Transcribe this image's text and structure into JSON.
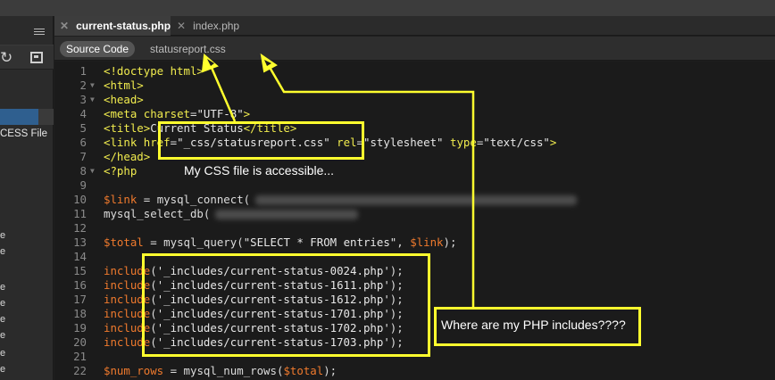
{
  "tabs": [
    {
      "label": "current-status.php",
      "active": true
    },
    {
      "label": "index.php",
      "active": false
    }
  ],
  "related_files": {
    "source_code_label": "Source Code",
    "files": [
      "statusreport.css"
    ]
  },
  "left_panel": {
    "file_label": "CESS File",
    "row_letter": "e"
  },
  "code_lines": [
    {
      "n": "1",
      "fold": false,
      "tokens": [
        [
          "t-tag",
          "<!doctype html>"
        ]
      ]
    },
    {
      "n": "2",
      "fold": true,
      "tokens": [
        [
          "t-tag",
          "<html>"
        ]
      ]
    },
    {
      "n": "3",
      "fold": true,
      "tokens": [
        [
          "t-tag",
          "<head>"
        ]
      ]
    },
    {
      "n": "4",
      "fold": false,
      "tokens": [
        [
          "t-tag",
          "<meta "
        ],
        [
          "t-attr",
          "charset"
        ],
        [
          "t-plain",
          "="
        ],
        [
          "t-str",
          "\"UTF-8\""
        ],
        [
          "t-tag",
          ">"
        ]
      ]
    },
    {
      "n": "5",
      "fold": false,
      "tokens": [
        [
          "t-tag",
          "<title>"
        ],
        [
          "t-text",
          "Current Status"
        ],
        [
          "t-tag",
          "</title>"
        ]
      ]
    },
    {
      "n": "6",
      "fold": false,
      "tokens": [
        [
          "t-tag",
          "<link "
        ],
        [
          "t-attr",
          "href"
        ],
        [
          "t-plain",
          "="
        ],
        [
          "t-str",
          "\"_css/statusreport.css\""
        ],
        [
          "t-plain",
          " "
        ],
        [
          "t-attr",
          "rel"
        ],
        [
          "t-plain",
          "="
        ],
        [
          "t-str",
          "\"stylesheet\""
        ],
        [
          "t-plain",
          " "
        ],
        [
          "t-attr",
          "type"
        ],
        [
          "t-plain",
          "="
        ],
        [
          "t-str",
          "\"text/css\""
        ],
        [
          "t-tag",
          ">"
        ]
      ]
    },
    {
      "n": "7",
      "fold": false,
      "tokens": [
        [
          "t-tag",
          "</head>"
        ]
      ]
    },
    {
      "n": "8",
      "fold": true,
      "tokens": [
        [
          "t-tag",
          "<?php"
        ]
      ]
    },
    {
      "n": "9",
      "fold": false,
      "tokens": []
    },
    {
      "n": "10",
      "fold": false,
      "tokens": [
        [
          "t-var",
          "$link"
        ],
        [
          "t-plain",
          " = "
        ],
        [
          "t-fn",
          "mysql_connect("
        ]
      ],
      "blur": 360
    },
    {
      "n": "11",
      "fold": false,
      "tokens": [
        [
          "t-fn",
          "mysql_select_db("
        ]
      ],
      "blur": 160
    },
    {
      "n": "12",
      "fold": false,
      "tokens": []
    },
    {
      "n": "13",
      "fold": false,
      "tokens": [
        [
          "t-var",
          "$total"
        ],
        [
          "t-plain",
          " = "
        ],
        [
          "t-fn",
          "mysql_query("
        ],
        [
          "t-str",
          "\"SELECT * FROM entries\""
        ],
        [
          "t-plain",
          ", "
        ],
        [
          "t-var",
          "$link"
        ],
        [
          "t-plain",
          ");"
        ]
      ]
    },
    {
      "n": "14",
      "fold": false,
      "tokens": []
    },
    {
      "n": "15",
      "fold": false,
      "tokens": [
        [
          "t-kw",
          "include"
        ],
        [
          "t-plain",
          "("
        ],
        [
          "t-str",
          "'_includes/current-status-0024.php'"
        ],
        [
          "t-plain",
          ");"
        ]
      ]
    },
    {
      "n": "16",
      "fold": false,
      "tokens": [
        [
          "t-kw",
          "include"
        ],
        [
          "t-plain",
          "("
        ],
        [
          "t-str",
          "'_includes/current-status-1611.php'"
        ],
        [
          "t-plain",
          ");"
        ]
      ]
    },
    {
      "n": "17",
      "fold": false,
      "tokens": [
        [
          "t-kw",
          "include"
        ],
        [
          "t-plain",
          "("
        ],
        [
          "t-str",
          "'_includes/current-status-1612.php'"
        ],
        [
          "t-plain",
          ");"
        ]
      ]
    },
    {
      "n": "18",
      "fold": false,
      "tokens": [
        [
          "t-kw",
          "include"
        ],
        [
          "t-plain",
          "("
        ],
        [
          "t-str",
          "'_includes/current-status-1701.php'"
        ],
        [
          "t-plain",
          ");"
        ]
      ]
    },
    {
      "n": "19",
      "fold": false,
      "tokens": [
        [
          "t-kw",
          "include"
        ],
        [
          "t-plain",
          "("
        ],
        [
          "t-str",
          "'_includes/current-status-1702.php'"
        ],
        [
          "t-plain",
          ");"
        ]
      ]
    },
    {
      "n": "20",
      "fold": false,
      "tokens": [
        [
          "t-kw",
          "include"
        ],
        [
          "t-plain",
          "("
        ],
        [
          "t-str",
          "'_includes/current-status-1703.php'"
        ],
        [
          "t-plain",
          ");"
        ]
      ]
    },
    {
      "n": "21",
      "fold": false,
      "tokens": []
    },
    {
      "n": "22",
      "fold": false,
      "tokens": [
        [
          "t-var",
          "$num_rows"
        ],
        [
          "t-plain",
          " = "
        ],
        [
          "t-fn",
          "mysql_num_rows("
        ],
        [
          "t-var",
          "$total"
        ],
        [
          "t-plain",
          ");"
        ]
      ]
    }
  ],
  "annotations": {
    "css_note": "My CSS file is accessible...",
    "php_note": "Where are my PHP includes????",
    "color": "#ffff2e"
  },
  "colors": {
    "tag": "#f1ec4e",
    "variable": "#f07a2d",
    "background": "#1b1b1b"
  }
}
